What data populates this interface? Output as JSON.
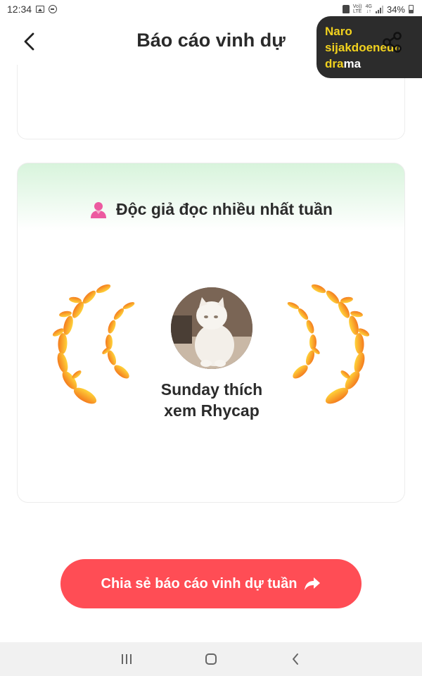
{
  "status_bar": {
    "time": "12:34",
    "network_top": "Vo))",
    "network_bottom": "LTE",
    "gen_top": "4G",
    "gen_bottom": "↓↑",
    "battery_percent": "34%"
  },
  "header": {
    "title": "Báo cáo vinh dự"
  },
  "floating_bubble": {
    "line1_highlight": "Naro",
    "line1_rest": "",
    "line2_highlight": "sijakdoeneun",
    "line2_rest": "",
    "line3_highlight": "dra",
    "line3_rest": "ma"
  },
  "honor_card": {
    "heading": "Độc giả đọc nhiều nhất tuần",
    "reader_name_line1": "Sunday thích",
    "reader_name_line2": "xem Rhycap"
  },
  "cta": {
    "label": "Chia sẻ báo cáo vinh dự tuần"
  },
  "colors": {
    "accent_red": "#ff4d55",
    "card_green": "#d8f4dc",
    "laurel_gold": "#f5a623",
    "bubble_text_yellow": "#f2d21e"
  },
  "icons": [
    "back-arrow-icon",
    "share-icon",
    "reader-icon",
    "share-arrow-icon",
    "laurel-icon",
    "recent-apps-icon",
    "home-icon",
    "back-nav-icon"
  ]
}
